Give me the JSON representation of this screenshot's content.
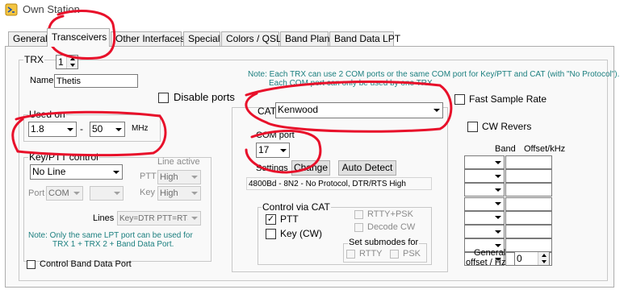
{
  "window": {
    "title": "Own Station",
    "icon": "app-icon"
  },
  "tabs": [
    {
      "label": "General"
    },
    {
      "label": "Transceivers",
      "active": true
    },
    {
      "label": "Other Interfaces"
    },
    {
      "label": "Special"
    },
    {
      "label": "Colors / QSL"
    },
    {
      "label": "Band Plan"
    },
    {
      "label": "Band Data LPT"
    }
  ],
  "trx": {
    "group_label": "TRX",
    "number": "1",
    "name_label": "Name",
    "name_value": "Thetis",
    "disable_ports_label": "Disable ports",
    "disable_ports_checked": false
  },
  "note_top": {
    "line1": "Note: Each TRX can use 2 COM ports or the same COM port for Key/PTT and CAT (with \"No Protocol\").",
    "line2": "Each COM port can only be used by one TRX."
  },
  "used_on": {
    "label": "Used on",
    "from": "1.8",
    "dash": "-",
    "to": "50",
    "unit": "MHz"
  },
  "key_ptt": {
    "label": "Key/PTT control",
    "mode": "No Line",
    "line_active_label": "Line active",
    "ptt_label": "PTT",
    "ptt_value": "High",
    "key_label": "Key",
    "key_value": "High",
    "port_label": "Port",
    "port_value": "COM",
    "port_number": "",
    "lines_label": "Lines",
    "lines_value": "Key=DTR PTT=RTS",
    "note_line1": "Note: Only the same LPT port can be used for",
    "note_line2": "TRX 1 + TRX 2 + Band Data Port."
  },
  "control_band_data_port": {
    "label": "Control Band Data Port",
    "checked": false
  },
  "cat": {
    "label": "CAT",
    "value": "Kenwood",
    "com_port_label": "COM port",
    "com_port_value": "17",
    "settings_label": "Settings",
    "change_button": "Change",
    "auto_detect_button": "Auto Detect",
    "settings_summary": "4800Bd - 8N2 - No Protocol, DTR/RTS High"
  },
  "control_via_cat": {
    "label": "Control via CAT",
    "ptt": {
      "label": "PTT",
      "checked": true
    },
    "key_cw": {
      "label": "Key (CW)",
      "checked": false
    },
    "rtty_psk": {
      "label": "RTTY+PSK",
      "checked": false
    },
    "decode_cw": {
      "label": "Decode CW",
      "checked": false
    },
    "submodes_label": "Set submodes for",
    "rtty": {
      "label": "RTTY",
      "checked": false
    },
    "psk": {
      "label": "PSK",
      "checked": false
    }
  },
  "fast_sample_rate": {
    "label": "Fast Sample Rate",
    "checked": false
  },
  "cw_revers": {
    "label": "CW Revers",
    "checked": false
  },
  "band_table": {
    "band_header": "Band",
    "offset_header": "Offset/kHz",
    "rows": [
      "",
      "",
      "",
      "",
      "",
      "",
      "",
      ""
    ]
  },
  "general_offset": {
    "label_line1": "General",
    "label_line2": "offset / Hz",
    "value": "0"
  },
  "annotation_color": "#e8102a"
}
